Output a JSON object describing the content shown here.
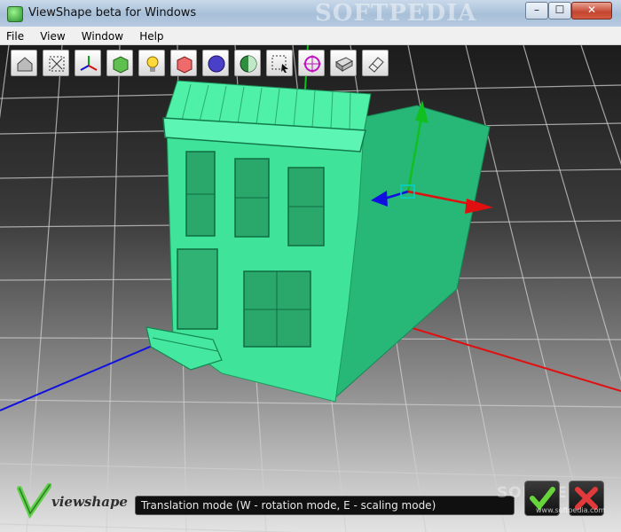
{
  "window": {
    "title": "ViewShape beta for Windows",
    "watermark": "SOFTPEDIA"
  },
  "controls": {
    "minimize": "–",
    "maximize": "☐",
    "close": "✕"
  },
  "menu": [
    "File",
    "View",
    "Window",
    "Help"
  ],
  "toolbar": [
    "home-view",
    "fit-view",
    "axes",
    "textured-cube",
    "light-bulb",
    "shaded-cube",
    "sphere",
    "split-sphere",
    "selection",
    "transform-gizmo",
    "eraser-box",
    "eraser"
  ],
  "status": {
    "text": "Translation mode (W - rotation mode, E - scaling mode)"
  },
  "branding": {
    "logo": "viewshape",
    "watermark_bottom": "SOFTPEDIA",
    "watermark_url": "www.softpedia.com"
  },
  "colors": {
    "model": "#2fd08a",
    "axis_x": "#e01010",
    "axis_y": "#10c020",
    "axis_z": "#1010e0",
    "status_bg": "#101010"
  }
}
